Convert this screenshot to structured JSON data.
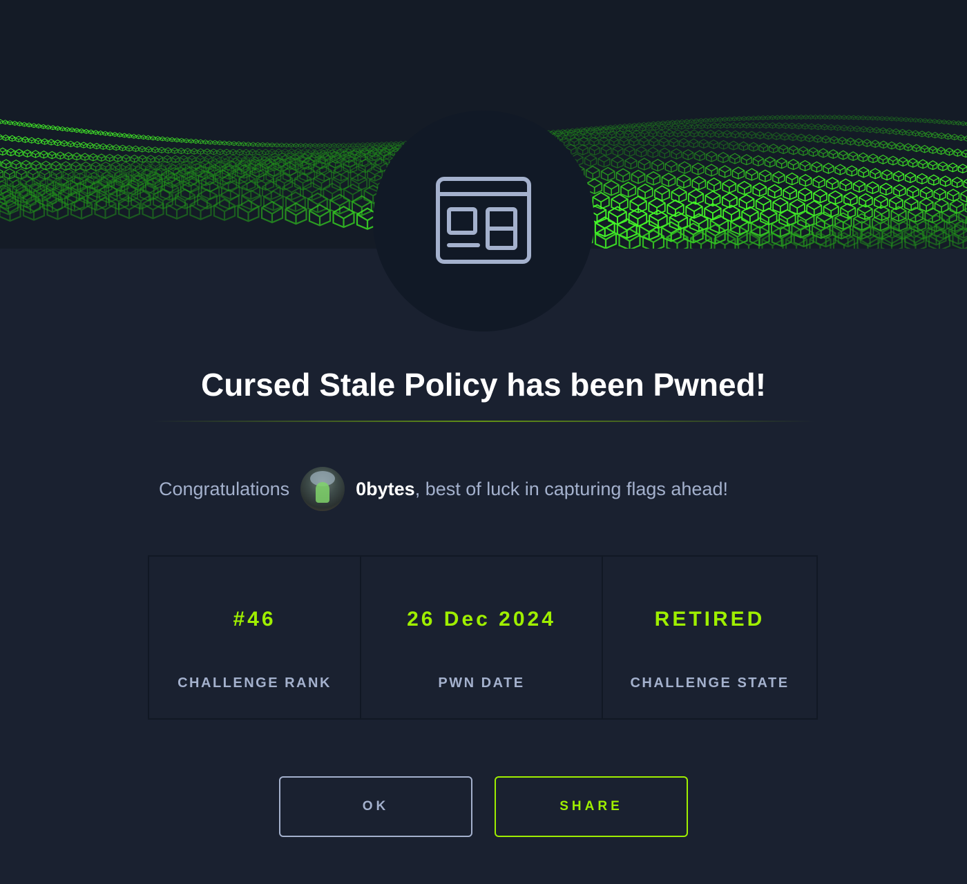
{
  "banner": {
    "icon": "browser-window-icon"
  },
  "title": "Cursed Stale Policy has been Pwned!",
  "congrats": {
    "prefix": "Congratulations",
    "username": "0bytes",
    "suffix": ", best of luck in capturing flags ahead!"
  },
  "stats": [
    {
      "value": "#46",
      "label": "CHALLENGE RANK"
    },
    {
      "value": "26 Dec 2024",
      "label": "PWN DATE"
    },
    {
      "value": "RETIRED",
      "label": "CHALLENGE STATE"
    }
  ],
  "buttons": {
    "ok": "OK",
    "share": "SHARE"
  },
  "colors": {
    "accent": "#9fef00",
    "background": "#1a2130",
    "muted": "#a4b1cd"
  }
}
